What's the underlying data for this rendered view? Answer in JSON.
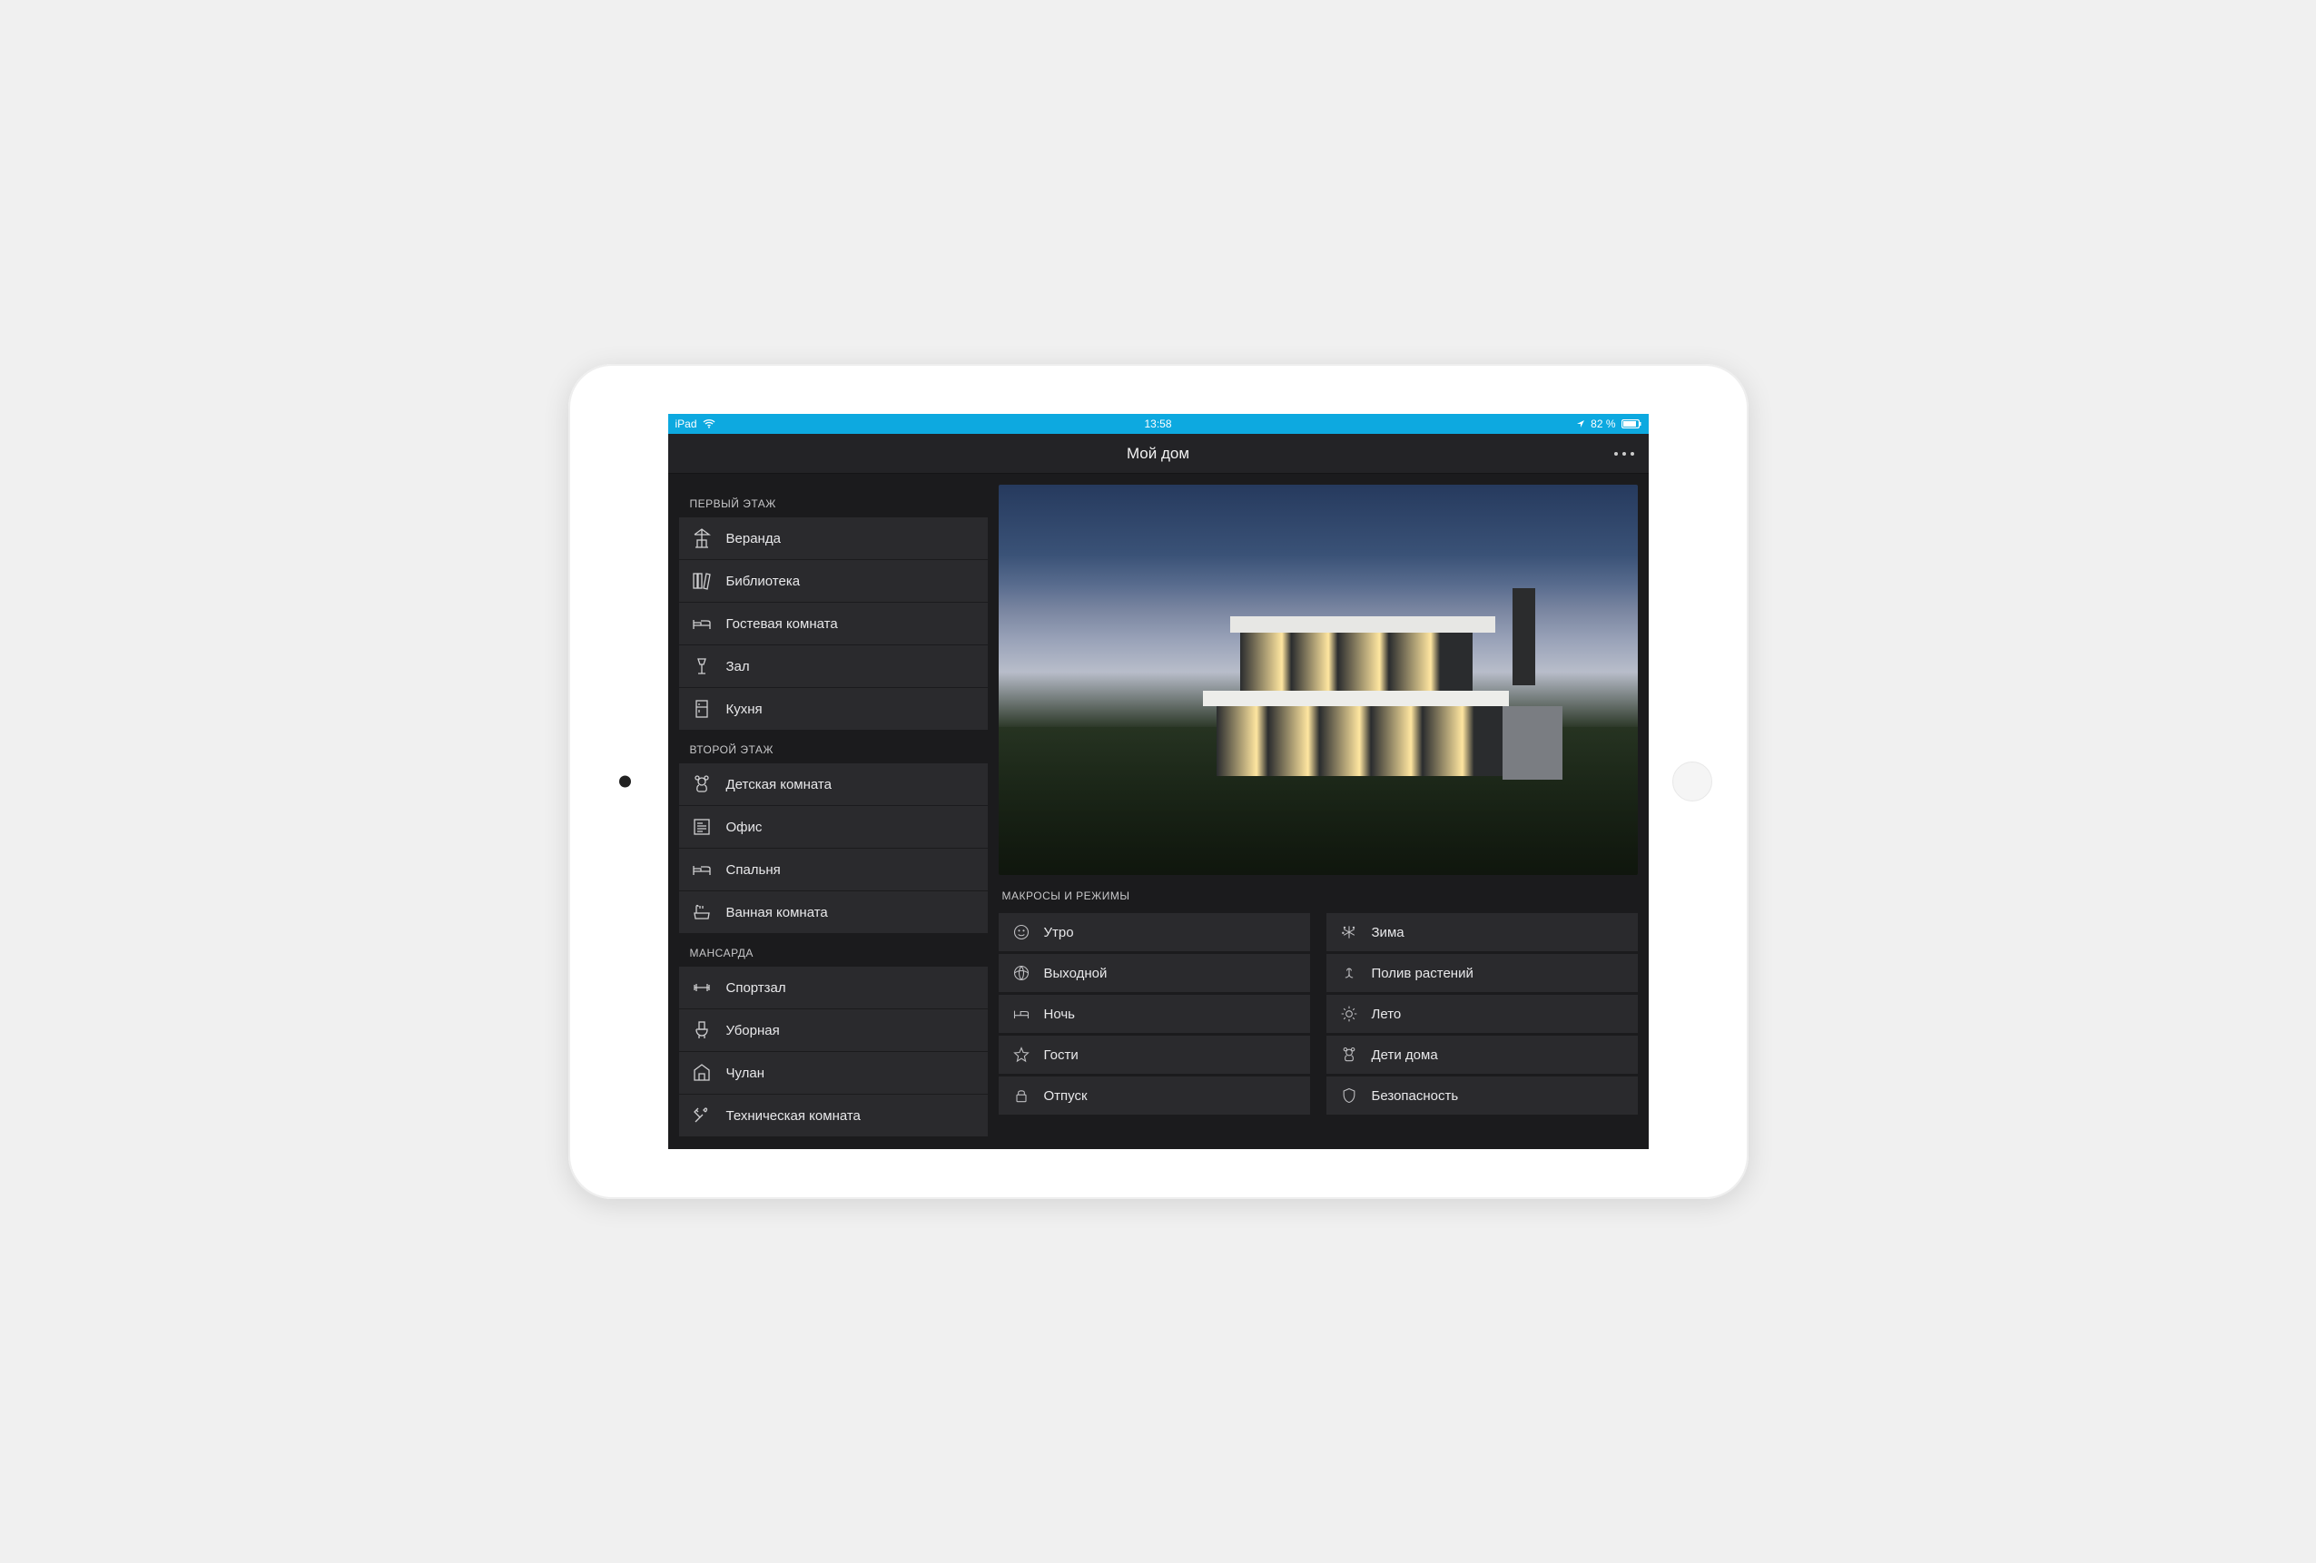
{
  "status_bar": {
    "device": "iPad",
    "time": "13:58",
    "battery": "82 %"
  },
  "nav": {
    "title": "Мой дом"
  },
  "sidebar": {
    "sections": [
      {
        "title": "ПЕРВЫЙ ЭТАЖ",
        "rooms": [
          {
            "icon": "patio-icon",
            "label": "Веранда"
          },
          {
            "icon": "books-icon",
            "label": "Библиотека"
          },
          {
            "icon": "bed-icon",
            "label": "Гостевая комната"
          },
          {
            "icon": "lamp-icon",
            "label": "Зал"
          },
          {
            "icon": "fridge-icon",
            "label": "Кухня"
          }
        ]
      },
      {
        "title": "ВТОРОЙ ЭТАЖ",
        "rooms": [
          {
            "icon": "teddy-icon",
            "label": "Детская комната"
          },
          {
            "icon": "newspaper-icon",
            "label": "Офис"
          },
          {
            "icon": "bed-icon",
            "label": "Спальня"
          },
          {
            "icon": "bath-icon",
            "label": "Ванная комната"
          }
        ]
      },
      {
        "title": "МАНСАРДА",
        "rooms": [
          {
            "icon": "dumbbell-icon",
            "label": "Спортзал"
          },
          {
            "icon": "toilet-icon",
            "label": "Уборная"
          },
          {
            "icon": "storage-icon",
            "label": "Чулан"
          },
          {
            "icon": "tools-icon",
            "label": "Техническая комната"
          }
        ]
      }
    ]
  },
  "macros": {
    "header": "МАКРОСЫ И РЕЖИМЫ",
    "col1": [
      {
        "icon": "smile-icon",
        "label": "Утро"
      },
      {
        "icon": "ball-icon",
        "label": "Выходной"
      },
      {
        "icon": "bed-icon",
        "label": "Ночь"
      },
      {
        "icon": "star-icon",
        "label": "Гости"
      },
      {
        "icon": "lock-icon",
        "label": "Отпуск"
      }
    ],
    "col2": [
      {
        "icon": "snow-icon",
        "label": "Зима"
      },
      {
        "icon": "plant-icon",
        "label": "Полив растений"
      },
      {
        "icon": "sun-icon",
        "label": "Лето"
      },
      {
        "icon": "teddy-icon",
        "label": "Дети дома"
      },
      {
        "icon": "shield-icon",
        "label": "Безопасность"
      }
    ]
  }
}
